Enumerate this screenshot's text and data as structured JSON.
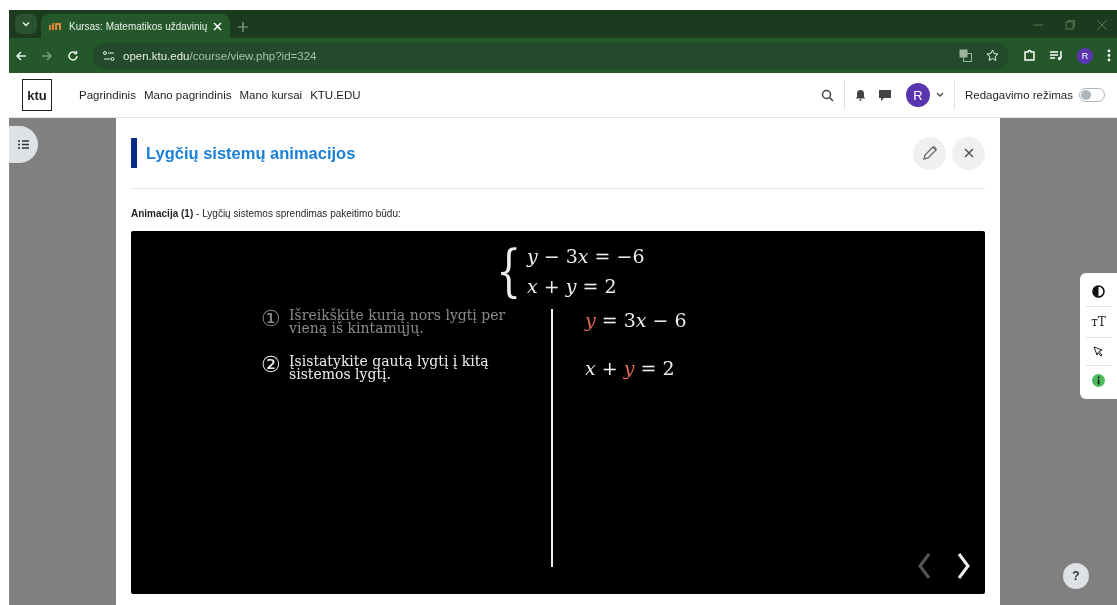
{
  "browser": {
    "tabs": [
      {
        "title": "Kursas: Matematikos uždavinių",
        "selected": true
      }
    ],
    "url_host": "open.ktu.edu",
    "url_path": "/course/view.php?id=324",
    "profile_initial": "R"
  },
  "navbar": {
    "logo": "ktu",
    "links": [
      {
        "label": "Pagrindinis"
      },
      {
        "label": "Mano pagrindinis"
      },
      {
        "label": "Mano kursai"
      },
      {
        "label": "KTU.EDU"
      }
    ],
    "user_initial": "R",
    "edit_mode": {
      "label": "Redagavimo režimas",
      "on": false
    }
  },
  "section": {
    "title": "Lygčių sistemų animacijos",
    "caption": "**Animacija (1)** - Lygčių sistemos sprendimas pakeitimo būdu:"
  },
  "animation": {
    "brace": "{",
    "system": [
      [
        "*y*",
        " − 3",
        "*x*",
        " = −6"
      ],
      [
        "*x*",
        " + ",
        "*y*",
        " = 2"
      ]
    ],
    "steps": [
      {
        "number": "①",
        "text": "Išreikškite kurią nors lygtį per vieną iš kintamųjų.",
        "active": false
      },
      {
        "number": "②",
        "text": "Įsistatykite gautą lygtį į kitą sistemos lygtį.",
        "active": true
      }
    ],
    "results": [
      [
        {
          "text": "*y*",
          "highlight": true
        },
        {
          "text": " = 3",
          "highlight": false
        },
        {
          "text": "*x*",
          "highlight": false
        },
        {
          "text": " − 6",
          "highlight": false
        }
      ],
      [
        {
          "text": "*x*",
          "highlight": false
        },
        {
          "text": " + ",
          "highlight": false
        },
        {
          "text": "*y*",
          "highlight": true
        },
        {
          "text": " = 2",
          "highlight": false
        }
      ]
    ],
    "prev_disabled": true,
    "next_disabled": false
  },
  "a11y_toolbar": {
    "text_size_label": "тT"
  },
  "help_label": "?"
}
